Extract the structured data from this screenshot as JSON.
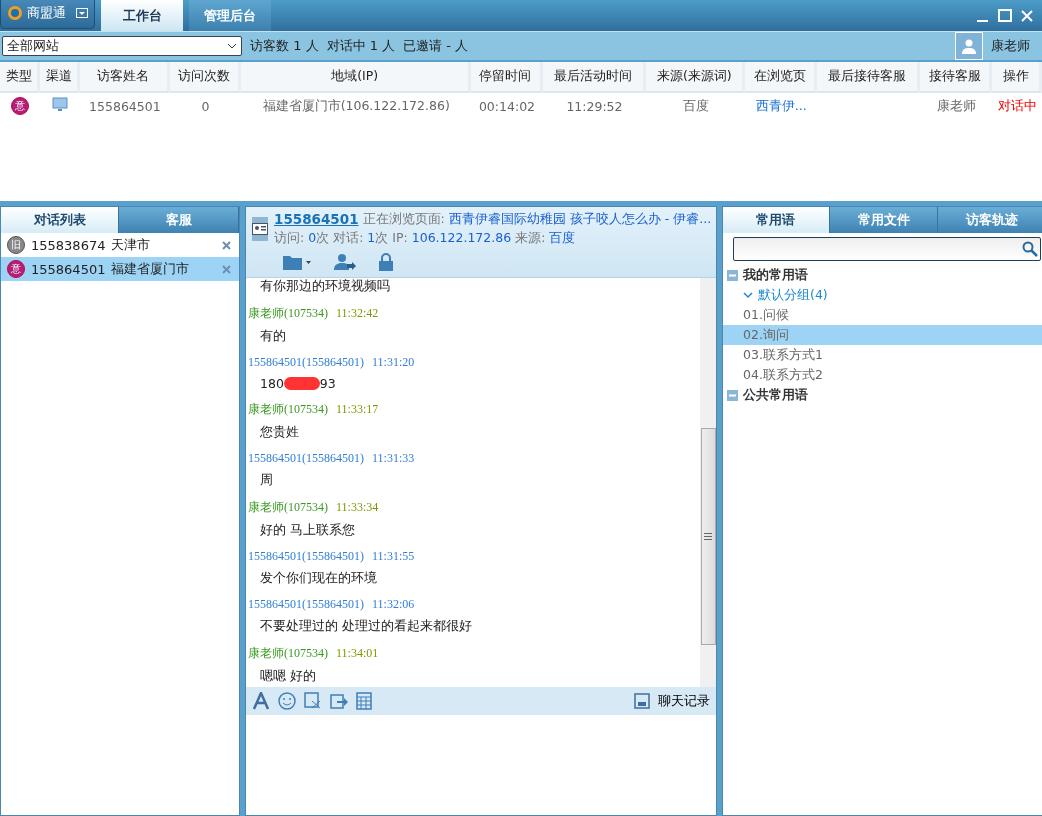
{
  "app": {
    "name": "商盟通"
  },
  "main_tabs": [
    {
      "label": "工作台",
      "selected": true
    },
    {
      "label": "管理后台",
      "selected": false
    }
  ],
  "toolbar": {
    "site_select": "全部网站",
    "stats": [
      "访客数 1 人",
      "对话中 1 人",
      "已邀请 - 人"
    ],
    "user": "康老师"
  },
  "visitor_table": {
    "columns": [
      "类型",
      "渠道",
      "访客姓名",
      "访问次数",
      "地域(IP)",
      "停留时间",
      "最后活动时间",
      "来源(来源词)",
      "在浏览页",
      "最后接待客服",
      "接待客服",
      "操作"
    ],
    "rows": [
      {
        "type_badge": "意",
        "name": "155864501",
        "visits": "0",
        "region": "福建省厦门市(106.122.172.86)",
        "stay": "00:14:02",
        "last_active": "11:29:52",
        "source": "百度",
        "page": "西青伊...",
        "agent": "康老师",
        "action": "对话中"
      }
    ]
  },
  "left_panel": {
    "tabs": [
      {
        "label": "对话列表",
        "selected": true
      },
      {
        "label": "客服",
        "selected": false
      }
    ],
    "items": [
      {
        "badge": "旧",
        "kind": "old",
        "name": "155838674",
        "city": "天津市",
        "selected": false
      },
      {
        "badge": "意",
        "kind": "intent",
        "name": "155864501",
        "city": "福建省厦门市",
        "selected": true
      }
    ]
  },
  "chat": {
    "visitor": "155864501",
    "browsing_label": "正在浏览页面:",
    "browsing_page": "西青伊睿国际幼稚园  孩子咬人怎么办 - 伊睿...",
    "info": [
      {
        "label": "访问:",
        "value": "0",
        "unit": "次"
      },
      {
        "label": "对话:",
        "value": "1",
        "unit": "次"
      },
      {
        "label": "IP:",
        "value": "106.122.172.86"
      },
      {
        "label": "来源:",
        "value": "百度"
      }
    ],
    "messages": [
      {
        "kind": "cut",
        "text": "有你那边的环境视频吗"
      },
      {
        "kind": "agent",
        "sender": "康老师(107534)",
        "time": "11:32:42",
        "text": "有的"
      },
      {
        "kind": "visitor",
        "sender": "155864501(155864501)",
        "time": "11:31:20",
        "text": "180",
        "text_after": "93",
        "redacted": true
      },
      {
        "kind": "agent",
        "sender": "康老师(107534)",
        "time": "11:33:17",
        "text": "您贵姓"
      },
      {
        "kind": "visitor",
        "sender": "155864501(155864501)",
        "time": "11:31:33",
        "text": "周"
      },
      {
        "kind": "agent",
        "sender": "康老师(107534)",
        "time": "11:33:34",
        "text": "好的 马上联系您"
      },
      {
        "kind": "visitor",
        "sender": "155864501(155864501)",
        "time": "11:31:55",
        "text": "发个你们现在的环境"
      },
      {
        "kind": "visitor",
        "sender": "155864501(155864501)",
        "time": "11:32:06",
        "text": "不要处理过的 处理过的看起来都很好"
      },
      {
        "kind": "agent",
        "sender": "康老师(107534)",
        "time": "11:34:01",
        "text": "嗯嗯 好的"
      }
    ],
    "history_button": "聊天记录"
  },
  "right_panel": {
    "tabs": [
      {
        "label": "常用语",
        "selected": true
      },
      {
        "label": "常用文件",
        "selected": false
      },
      {
        "label": "访客轨迹",
        "selected": false
      }
    ],
    "tree": [
      {
        "label": "我的常用语",
        "expanded": true,
        "children": [
          {
            "label": "默认分组(4)",
            "expanded": true,
            "children": [
              {
                "label": "01.问候",
                "selected": false
              },
              {
                "label": "02.询问",
                "selected": true
              },
              {
                "label": "03.联系方式1",
                "selected": false
              },
              {
                "label": "04.联系方式2",
                "selected": false
              }
            ]
          }
        ]
      },
      {
        "label": "公共常用语",
        "expanded": true
      }
    ]
  }
}
